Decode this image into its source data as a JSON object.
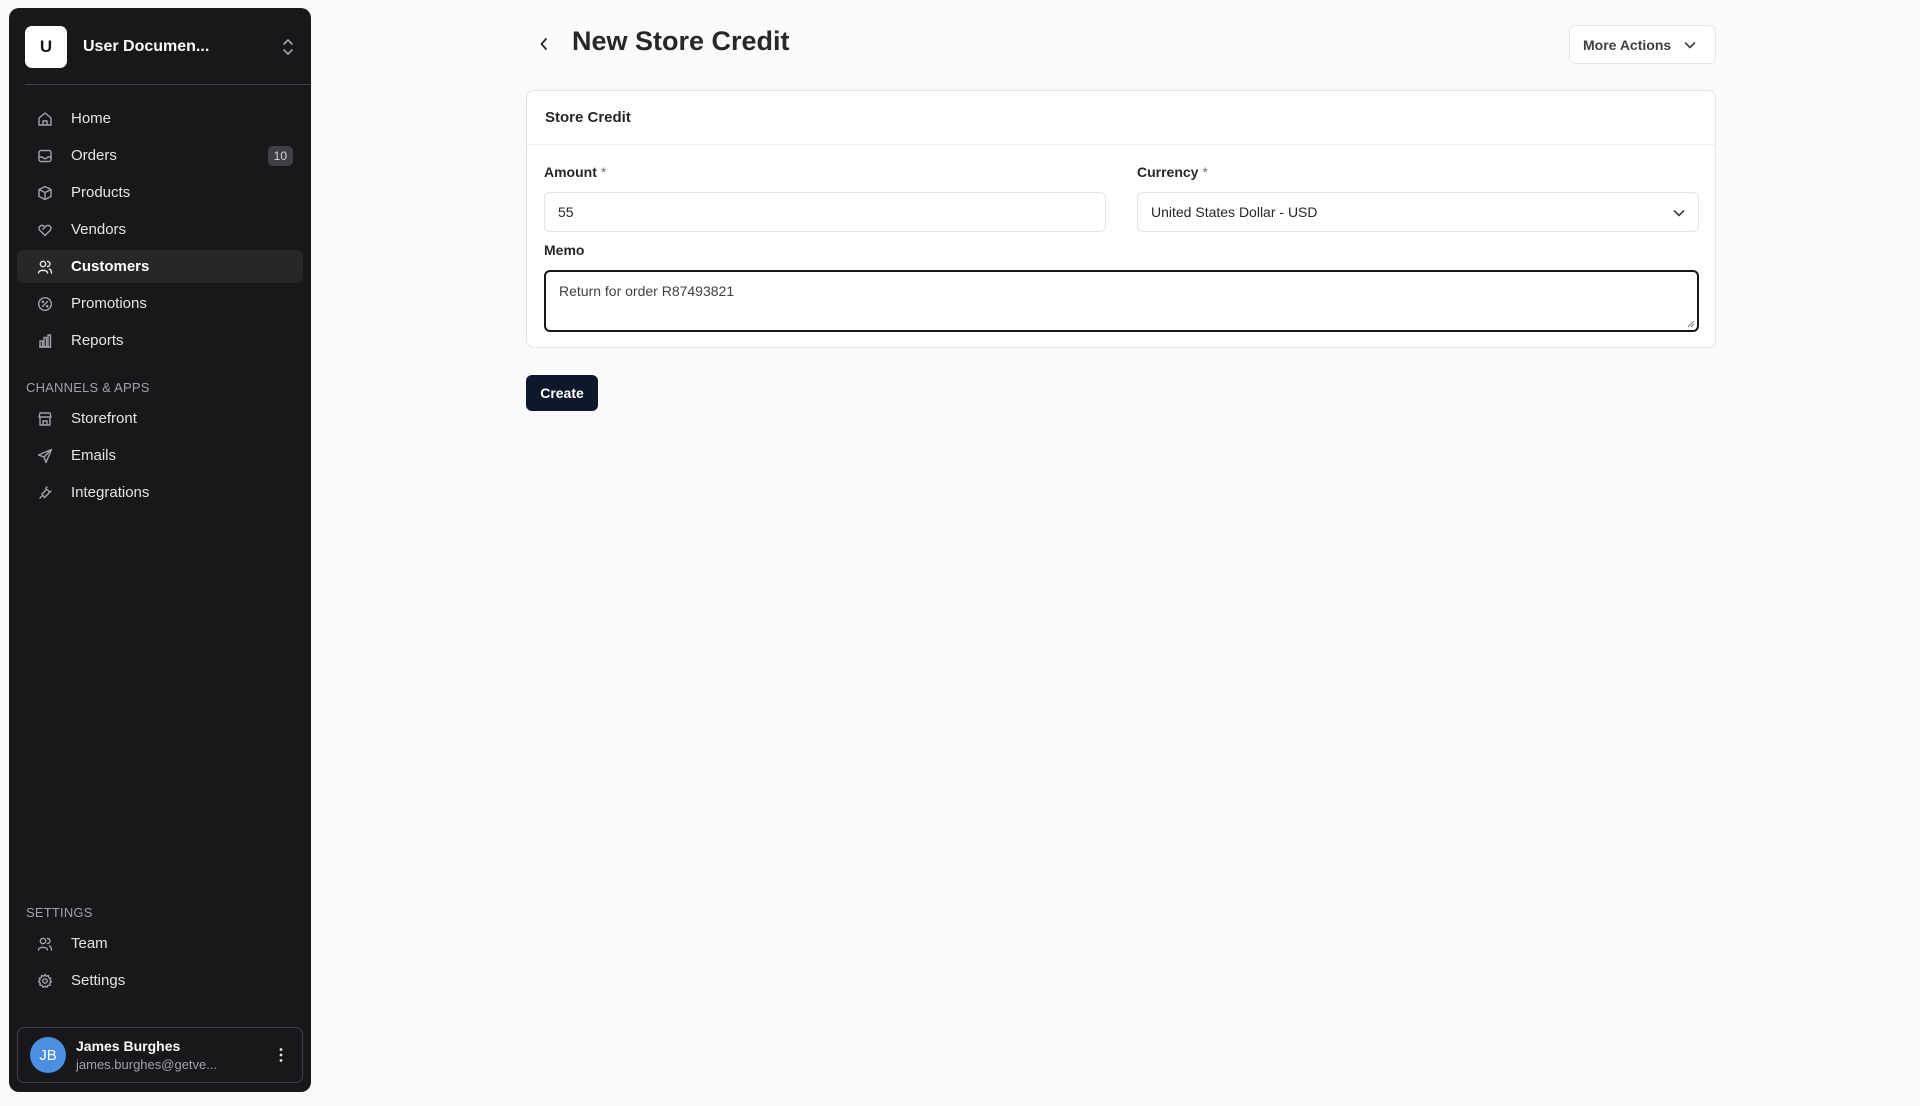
{
  "sidebar": {
    "store": {
      "avatar_letter": "U",
      "name": "User Documen..."
    },
    "main_nav": [
      {
        "label": "Home",
        "icon": "home-icon"
      },
      {
        "label": "Orders",
        "icon": "inbox-icon",
        "badge": "10"
      },
      {
        "label": "Products",
        "icon": "box-icon"
      },
      {
        "label": "Vendors",
        "icon": "handshake-icon"
      },
      {
        "label": "Customers",
        "icon": "users-icon",
        "active": true
      },
      {
        "label": "Promotions",
        "icon": "percent-badge-icon"
      },
      {
        "label": "Reports",
        "icon": "bar-chart-icon"
      }
    ],
    "channels_label": "CHANNELS & APPS",
    "channels_nav": [
      {
        "label": "Storefront",
        "icon": "store-icon"
      },
      {
        "label": "Emails",
        "icon": "send-icon"
      },
      {
        "label": "Integrations",
        "icon": "plug-icon"
      }
    ],
    "settings_label": "SETTINGS",
    "settings_nav": [
      {
        "label": "Team",
        "icon": "users-icon"
      },
      {
        "label": "Settings",
        "icon": "gear-icon"
      }
    ],
    "user": {
      "initials": "JB",
      "name": "James Burghes",
      "email": "james.burghes@getve..."
    }
  },
  "header": {
    "title": "New Store Credit",
    "more_actions_label": "More Actions"
  },
  "form": {
    "card_title": "Store Credit",
    "amount": {
      "label": "Amount",
      "required_mark": "*",
      "value": "55"
    },
    "currency": {
      "label": "Currency",
      "required_mark": "*",
      "value": "United States Dollar - USD"
    },
    "memo": {
      "label": "Memo",
      "value": "Return for order R87493821"
    },
    "submit_label": "Create"
  },
  "colors": {
    "sidebar_bg": "#18181b",
    "page_bg": "#fafafa",
    "primary_button": "#0f172a",
    "avatar_blue": "#4b8fe0"
  }
}
